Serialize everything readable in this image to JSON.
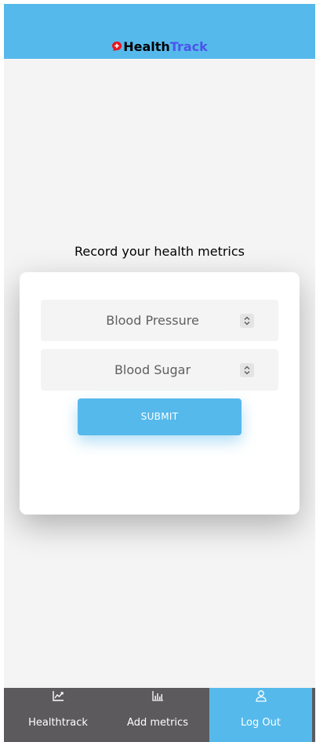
{
  "header": {
    "brand_part1": "Health",
    "brand_part2": "Track",
    "logo_icon": "red-speech-bubble-plus-icon",
    "background_color": "#56b9ec",
    "brand_accent_color": "#4a56e8"
  },
  "main": {
    "heading": "Record your health metrics",
    "fields": [
      {
        "placeholder": "Blood Pressure",
        "icon": "number-spinner-icon"
      },
      {
        "placeholder": "Blood Sugar",
        "icon": "number-spinner-icon"
      }
    ],
    "submit_label": "SUBMIT"
  },
  "bottom_nav": {
    "items": [
      {
        "label": "Healthtrack",
        "icon": "line-chart-icon",
        "active": false
      },
      {
        "label": "Add metrics",
        "icon": "bar-chart-icon",
        "active": false
      },
      {
        "label": "Log Out",
        "icon": "user-icon",
        "active": true
      }
    ],
    "background_color": "#5c5a5c",
    "active_color": "#56b9ec"
  }
}
